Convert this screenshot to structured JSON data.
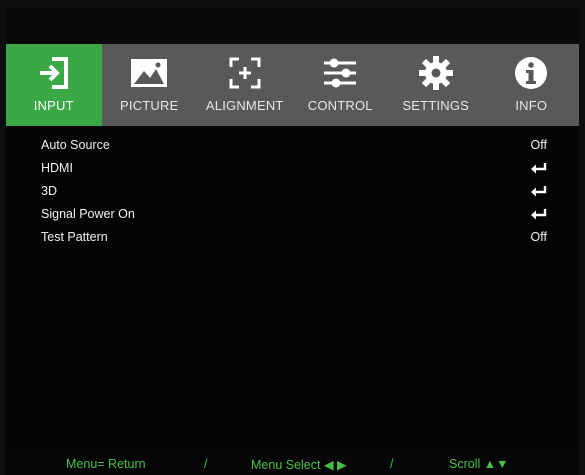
{
  "tabs": [
    {
      "label": "INPUT",
      "icon": "input-icon",
      "active": true
    },
    {
      "label": "PICTURE",
      "icon": "picture-icon",
      "active": false
    },
    {
      "label": "ALIGNMENT",
      "icon": "alignment-icon",
      "active": false
    },
    {
      "label": "CONTROL",
      "icon": "control-sliders-icon",
      "active": false
    },
    {
      "label": "SETTINGS",
      "icon": "gear-icon",
      "active": false
    },
    {
      "label": "INFO",
      "icon": "info-icon",
      "active": false
    }
  ],
  "menu": {
    "items": [
      {
        "label": "Auto Source",
        "value": "Off"
      },
      {
        "label": "HDMI",
        "value": "",
        "value_icon": "enter-icon"
      },
      {
        "label": "3D",
        "value": "",
        "value_icon": "enter-icon"
      },
      {
        "label": "Signal Power On",
        "value": "",
        "value_icon": "enter-icon"
      },
      {
        "label": "Test Pattern",
        "value": "Off"
      }
    ]
  },
  "footer": {
    "menu_return": "Menu= Return",
    "sep1": "/",
    "menu_select": "Menu Select ◀ ▶",
    "sep2": "/",
    "scroll": "Scroll ▲▼"
  },
  "colors": {
    "accent": "#3aa845",
    "tabbar": "#595959",
    "footer_text": "#48c04a"
  }
}
